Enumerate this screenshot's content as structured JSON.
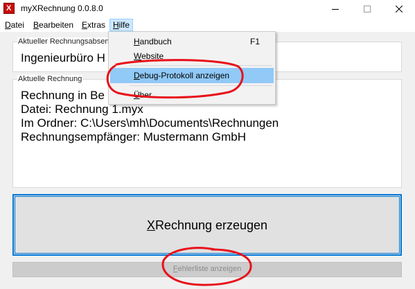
{
  "window": {
    "title": "myXRechnung 0.0.8.0",
    "app_icon_letter": "X",
    "controls": {
      "minimize": "minimize",
      "maximize": "maximize",
      "close": "close"
    }
  },
  "menubar": {
    "items": [
      {
        "mnemonic": "D",
        "rest": "atei"
      },
      {
        "mnemonic": "B",
        "rest": "earbeiten"
      },
      {
        "mnemonic": "E",
        "rest": "xtras"
      },
      {
        "mnemonic": "H",
        "rest": "ilfe"
      }
    ]
  },
  "sender_group": {
    "label": "Aktueller Rechnungsabsend",
    "value": "Ingenieurbüro H"
  },
  "invoice_group": {
    "label": "Aktuelle Rechnung",
    "lines": [
      "Rechnung in Be",
      "Datei: Rechnung 1.myx",
      "Im Ordner: C:\\Users\\mh\\Documents\\Rechnungen",
      "Rechnungsempfänger: Mustermann GmbH"
    ]
  },
  "help_menu": {
    "items": [
      {
        "mnemonic": "H",
        "rest": "andbuch",
        "shortcut": "F1"
      },
      {
        "mnemonic": "W",
        "rest": "ebsite",
        "shortcut": ""
      },
      {
        "mnemonic": "D",
        "rest": "ebug-Protokoll anzeigen",
        "shortcut": ""
      },
      {
        "mnemonic": "Ü",
        "rest": "ber...",
        "shortcut": ""
      }
    ]
  },
  "actions": {
    "create": {
      "mnemonic": "X",
      "rest": "Rechnung erzeugen"
    },
    "errors": {
      "mnemonic": "F",
      "rest": "ehlerliste anzeigen"
    }
  },
  "colors": {
    "accent": "#0078d7",
    "highlight": "#91c9f7",
    "annotation": "#e8101a"
  }
}
